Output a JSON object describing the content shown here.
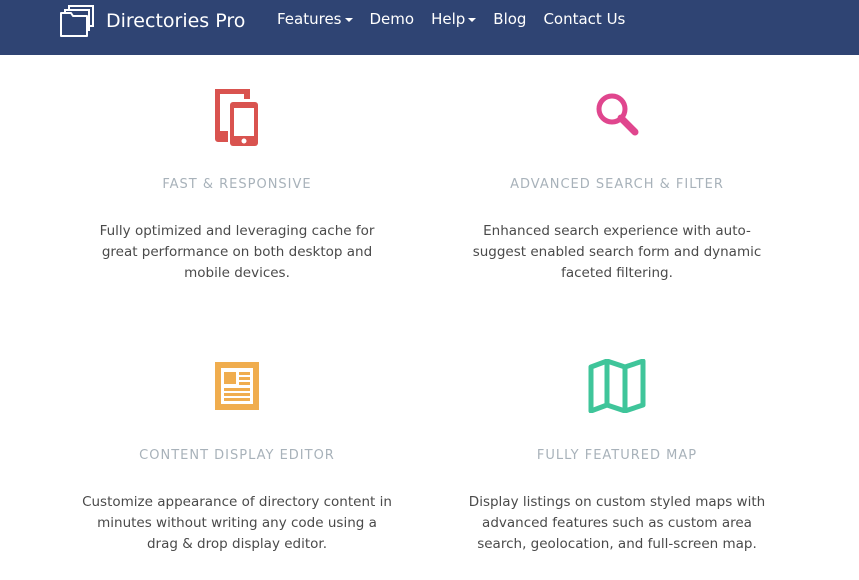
{
  "header": {
    "brand": "Directories Pro",
    "nav": [
      {
        "label": "Features",
        "dropdown": true
      },
      {
        "label": "Demo",
        "dropdown": false
      },
      {
        "label": "Help",
        "dropdown": true
      },
      {
        "label": "Blog",
        "dropdown": false
      },
      {
        "label": "Contact Us",
        "dropdown": false
      }
    ],
    "bg_color": "#2f4473"
  },
  "features": [
    {
      "icon": "tablet-phone-icon",
      "icon_color": "#d9534f",
      "title": "FAST & RESPONSIVE",
      "description": "Fully optimized and leveraging cache for great performance on both desktop and mobile devices."
    },
    {
      "icon": "search-icon",
      "icon_color": "#e0468e",
      "title": "ADVANCED SEARCH & FILTER",
      "description": "Enhanced search experience with auto-suggest enabled search form and dynamic faceted filtering."
    },
    {
      "icon": "newspaper-icon",
      "icon_color": "#f0ad4e",
      "title": "CONTENT DISPLAY EDITOR",
      "description": "Customize appearance of directory content in minutes without writing any code using a drag & drop display editor."
    },
    {
      "icon": "map-icon",
      "icon_color": "#3fc59a",
      "title": "FULLY FEATURED MAP",
      "description": "Display listings on custom styled maps with advanced features such as custom area search, geolocation, and full-screen map."
    }
  ]
}
